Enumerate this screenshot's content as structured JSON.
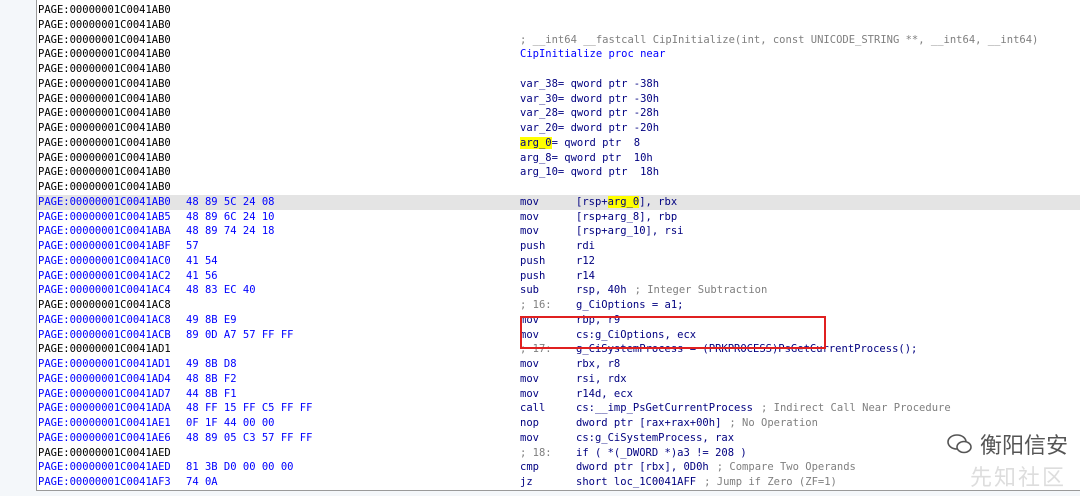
{
  "rows": [
    {
      "addr": "PAGE:00000001C0041AB0",
      "bytes": "",
      "c1": "",
      "op": "",
      "kind": "plain"
    },
    {
      "addr": "PAGE:00000001C0041AB0",
      "bytes": "",
      "c1": "",
      "op": "",
      "kind": "plain"
    },
    {
      "addr": "PAGE:00000001C0041AB0",
      "bytes": "",
      "c1": "; __int64 __fastcall CipInitialize(int, const UNICODE_STRING **, __int64, __int64)",
      "op": "",
      "kind": "comment"
    },
    {
      "addr": "PAGE:00000001C0041AB0",
      "bytes": "",
      "c1": "CipInitialize proc near",
      "op": "",
      "kind": "name"
    },
    {
      "addr": "PAGE:00000001C0041AB0",
      "bytes": "",
      "c1": "",
      "op": "",
      "kind": "plain"
    },
    {
      "addr": "PAGE:00000001C0041AB0",
      "bytes": "",
      "c1": "var_38= qword ptr -38h",
      "op": "",
      "kind": "var"
    },
    {
      "addr": "PAGE:00000001C0041AB0",
      "bytes": "",
      "c1": "var_30= dword ptr -30h",
      "op": "",
      "kind": "var"
    },
    {
      "addr": "PAGE:00000001C0041AB0",
      "bytes": "",
      "c1": "var_28= qword ptr -28h",
      "op": "",
      "kind": "var"
    },
    {
      "addr": "PAGE:00000001C0041AB0",
      "bytes": "",
      "c1": "var_20= dword ptr -20h",
      "op": "",
      "kind": "var"
    },
    {
      "addr": "PAGE:00000001C0041AB0",
      "bytes": "",
      "c1": "arg_0= qword ptr  8",
      "op": "",
      "kind": "arg0"
    },
    {
      "addr": "PAGE:00000001C0041AB0",
      "bytes": "",
      "c1": "arg_8= qword ptr  10h",
      "op": "",
      "kind": "var"
    },
    {
      "addr": "PAGE:00000001C0041AB0",
      "bytes": "",
      "c1": "arg_10= qword ptr  18h",
      "op": "",
      "kind": "var"
    },
    {
      "addr": "PAGE:00000001C0041AB0",
      "bytes": "",
      "c1": "",
      "op": "",
      "kind": "plain"
    },
    {
      "addr": "PAGE:00000001C0041AB0",
      "bytes": "48 89 5C 24 08",
      "c1": "mov",
      "op": "[rsp+arg_0], rbx",
      "kind": "ins-hl"
    },
    {
      "addr": "PAGE:00000001C0041AB5",
      "bytes": "48 89 6C 24 10",
      "c1": "mov",
      "op": "[rsp+arg_8], rbp",
      "kind": "ins"
    },
    {
      "addr": "PAGE:00000001C0041ABA",
      "bytes": "48 89 74 24 18",
      "c1": "mov",
      "op": "[rsp+arg_10], rsi",
      "kind": "ins"
    },
    {
      "addr": "PAGE:00000001C0041ABF",
      "bytes": "57",
      "c1": "push",
      "op": "rdi",
      "kind": "ins"
    },
    {
      "addr": "PAGE:00000001C0041AC0",
      "bytes": "41 54",
      "c1": "push",
      "op": "r12",
      "kind": "ins"
    },
    {
      "addr": "PAGE:00000001C0041AC2",
      "bytes": "41 56",
      "c1": "push",
      "op": "r14",
      "kind": "ins"
    },
    {
      "addr": "PAGE:00000001C0041AC4",
      "bytes": "48 83 EC 40",
      "c1": "sub",
      "op": "rsp, 40h",
      "cmt": "; Integer Subtraction",
      "kind": "ins"
    },
    {
      "addr": "PAGE:00000001C0041AC8",
      "bytes": "",
      "c1": "; 16:",
      "op": "g_CiOptions = a1;",
      "kind": "pseudo"
    },
    {
      "addr": "PAGE:00000001C0041AC8",
      "bytes": "49 8B E9",
      "c1": "mov",
      "op": "rbp, r9",
      "kind": "ins"
    },
    {
      "addr": "PAGE:00000001C0041ACB",
      "bytes": "89 0D A7 57 FF FF",
      "c1": "mov",
      "op": "cs:g_CiOptions, ecx",
      "kind": "ins"
    },
    {
      "addr": "PAGE:00000001C0041AD1",
      "bytes": "",
      "c1": "; 17:",
      "op": "g_CiSystemProcess = (PRKPROCESS)PsGetCurrentProcess();",
      "kind": "pseudo"
    },
    {
      "addr": "PAGE:00000001C0041AD1",
      "bytes": "49 8B D8",
      "c1": "mov",
      "op": "rbx, r8",
      "kind": "ins"
    },
    {
      "addr": "PAGE:00000001C0041AD4",
      "bytes": "48 8B F2",
      "c1": "mov",
      "op": "rsi, rdx",
      "kind": "ins"
    },
    {
      "addr": "PAGE:00000001C0041AD7",
      "bytes": "44 8B F1",
      "c1": "mov",
      "op": "r14d, ecx",
      "kind": "ins"
    },
    {
      "addr": "PAGE:00000001C0041ADA",
      "bytes": "48 FF 15 FF C5 FF FF",
      "c1": "call",
      "op": "cs:__imp_PsGetCurrentProcess",
      "cmt": "; Indirect Call Near Procedure",
      "kind": "ins"
    },
    {
      "addr": "PAGE:00000001C0041AE1",
      "bytes": "0F 1F 44 00 00",
      "c1": "nop",
      "op": "dword ptr [rax+rax+00h]",
      "cmt": "; No Operation",
      "kind": "ins"
    },
    {
      "addr": "PAGE:00000001C0041AE6",
      "bytes": "48 89 05 C3 57 FF FF",
      "c1": "mov",
      "op": "cs:g_CiSystemProcess, rax",
      "kind": "ins"
    },
    {
      "addr": "PAGE:00000001C0041AED",
      "bytes": "",
      "c1": "; 18:",
      "op": "if ( *(_DWORD *)a3 != 208 )",
      "kind": "pseudo"
    },
    {
      "addr": "PAGE:00000001C0041AED",
      "bytes": "81 3B D0 00 00 00",
      "c1": "cmp",
      "op": "dword ptr [rbx], 0D0h",
      "cmt": "; Compare Two Operands",
      "kind": "ins"
    },
    {
      "addr": "PAGE:00000001C0041AF3",
      "bytes": "74 0A",
      "c1": "jz",
      "op": "short loc_1C0041AFF",
      "cmt": "; Jump if Zero (ZF=1)",
      "kind": "ins"
    }
  ],
  "watermark": {
    "text": "衡阳信安",
    "text2": "先知社区",
    "icon": "wechat-icon"
  }
}
